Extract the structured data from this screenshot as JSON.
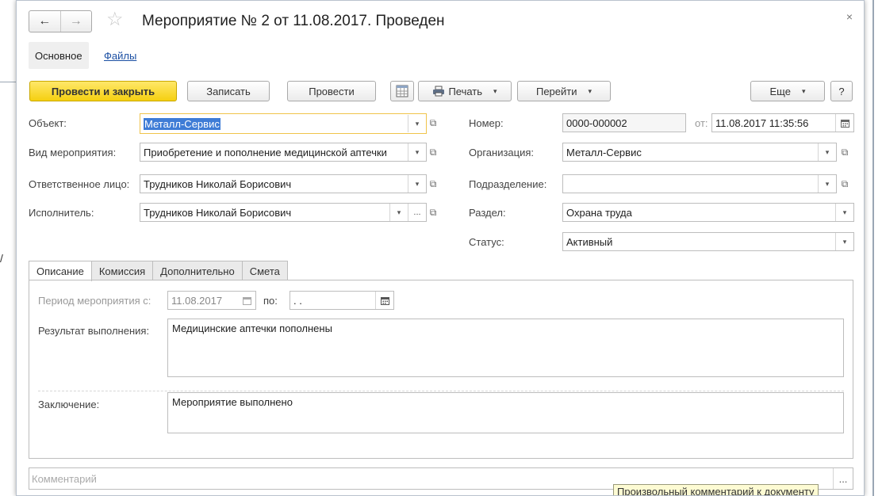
{
  "window": {
    "title": "Мероприятие № 2 от 11.08.2017. Проведен",
    "back_glyph": "←",
    "forward_glyph": "→",
    "star_glyph": "☆",
    "close_glyph": "×"
  },
  "subtabs": {
    "main": "Основное",
    "files": "Файлы"
  },
  "toolbar": {
    "post_close": "Провести и закрыть",
    "save": "Записать",
    "post": "Провести",
    "print": "Печать",
    "goto": "Перейти",
    "more": "Еще",
    "help": "?",
    "caret": "▾"
  },
  "left_fields": [
    {
      "label": "Объект:",
      "value": "Металл-Сервис"
    },
    {
      "label": "Вид мероприятия:",
      "value": "Приобретение и пополнение медицинской аптечки"
    },
    {
      "label": "Ответственное лицо:",
      "value": "Трудников Николай Борисович"
    },
    {
      "label": "Исполнитель:",
      "value": "Трудников Николай Борисович"
    }
  ],
  "right_fields": {
    "number_label": "Номер:",
    "number_value": "0000-000002",
    "date_label": "от:",
    "date_value": "11.08.2017 11:35:56",
    "org_label": "Организация:",
    "org_value": "Металл-Сервис",
    "dept_label": "Подразделение:",
    "dept_value": "",
    "section_label": "Раздел:",
    "section_value": "Охрана труда",
    "status_label": "Статус:",
    "status_value": "Активный"
  },
  "tabs": [
    "Описание",
    "Комиссия",
    "Дополнительно",
    "Смета"
  ],
  "description": {
    "period_label": "Период мероприятия с:",
    "period_from": "11.08.2017",
    "period_to_label": "по:",
    "period_to": ". .",
    "result_label": "Результат выполнения:",
    "result_value": "Медицинские аптечки пополнены",
    "conclusion_label": "Заключение:",
    "conclusion_value": "Мероприятие выполнено"
  },
  "comment": {
    "placeholder": "Комментарий",
    "dots": "...",
    "tooltip": "Произвольный комментарий к документу"
  },
  "icons": {
    "calendar": "calendar-icon",
    "open": "open-form-icon",
    "print": "printer-icon"
  }
}
